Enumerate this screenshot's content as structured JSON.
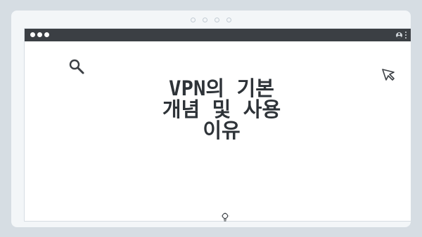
{
  "window": {
    "controls": [
      "close",
      "minimize",
      "maximize"
    ],
    "titlebar_icons": [
      "user-icon",
      "more-vert-icon"
    ]
  },
  "main": {
    "heading_lines": [
      "VPN의 기본",
      "개념 및 사용",
      "이유"
    ],
    "decorative_icons": [
      "search-icon",
      "cursor-icon",
      "lightbulb-icon"
    ]
  },
  "colors": {
    "background": "#d6dde3",
    "frame": "#f3f6f8",
    "titlebar": "#3b3f44",
    "content": "#ffffff",
    "text": "#2e3338"
  }
}
